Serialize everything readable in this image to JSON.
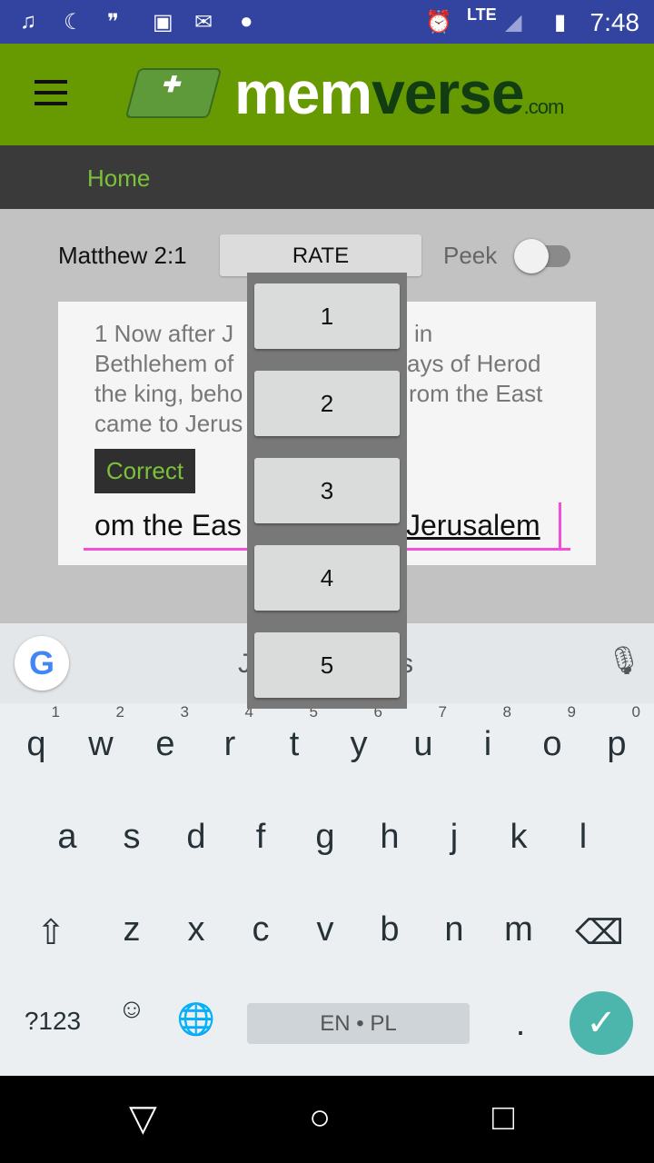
{
  "status": {
    "time": "7:48",
    "network": "LTE",
    "icons": [
      "music-icon",
      "moon-icon",
      "hangouts-icon",
      "image-icon",
      "gmail-icon",
      "android-icon",
      "alarm-icon",
      "signal-icon",
      "battery-charging-icon"
    ]
  },
  "appbar": {
    "logo_a": "mem",
    "logo_b": "verse",
    "logo_c": ".com"
  },
  "nav": {
    "home": "Home"
  },
  "toolbar": {
    "reference": "Matthew 2:1",
    "rate": "RATE",
    "peek": "Peek",
    "peek_on": false
  },
  "verse": {
    "lines_left": [
      "1 Now after J",
      "Bethlehem of",
      "the king, beho",
      "came to Jerus"
    ],
    "lines_right": [
      "in",
      "ays of Herod",
      "rom the East",
      ""
    ],
    "correct": "Correct",
    "input_left": "om the Eas",
    "input_right": "Jerusalem"
  },
  "rate_options": [
    "1",
    "2",
    "3",
    "4",
    "5"
  ],
  "keyboard": {
    "suggestion_left": "J",
    "suggestion_right": "s",
    "row1": [
      [
        "q",
        "1"
      ],
      [
        "w",
        "2"
      ],
      [
        "e",
        "3"
      ],
      [
        "r",
        "4"
      ],
      [
        "t",
        "5"
      ],
      [
        "y",
        "6"
      ],
      [
        "u",
        "7"
      ],
      [
        "i",
        "8"
      ],
      [
        "o",
        "9"
      ],
      [
        "p",
        "0"
      ]
    ],
    "row2": [
      "a",
      "s",
      "d",
      "f",
      "g",
      "h",
      "j",
      "k",
      "l"
    ],
    "row3": [
      "z",
      "x",
      "c",
      "v",
      "b",
      "n",
      "m"
    ],
    "symbols": "?123",
    "space": "EN • PL",
    "period": "."
  }
}
